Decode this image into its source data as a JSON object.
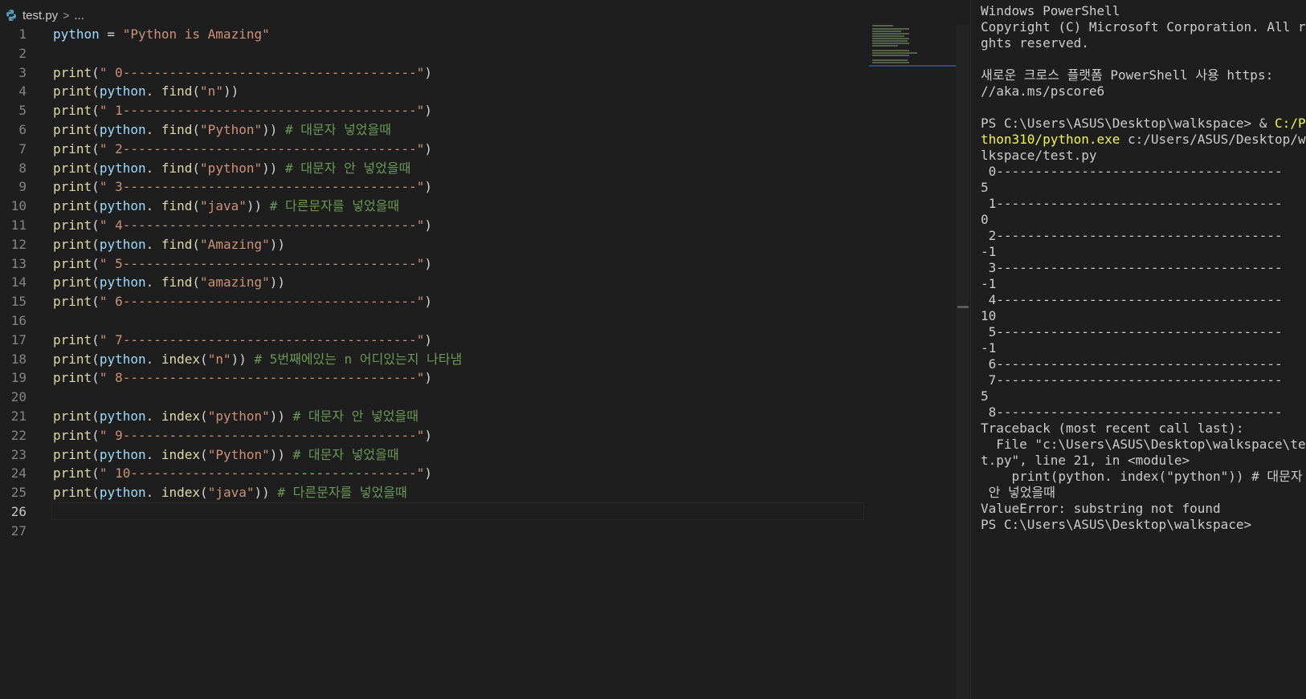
{
  "editor": {
    "breadcrumb": {
      "file": "test.py",
      "separator": ">",
      "more": "..."
    },
    "current_line": 26,
    "lines": [
      {
        "n": "1",
        "tokens": [
          [
            "var",
            "python"
          ],
          [
            "p",
            " = "
          ],
          [
            "str",
            "\"Python is Amazing\""
          ]
        ]
      },
      {
        "n": "2",
        "tokens": []
      },
      {
        "n": "3",
        "tokens": [
          [
            "fn",
            "print"
          ],
          [
            "p",
            "("
          ],
          [
            "str",
            "\" 0--------------------------------------\""
          ],
          [
            "p",
            ")"
          ]
        ]
      },
      {
        "n": "4",
        "tokens": [
          [
            "fn",
            "print"
          ],
          [
            "p",
            "("
          ],
          [
            "var",
            "python"
          ],
          [
            "p",
            ". "
          ],
          [
            "fn",
            "find"
          ],
          [
            "p",
            "("
          ],
          [
            "str",
            "\"n\""
          ],
          [
            "p",
            "))"
          ]
        ]
      },
      {
        "n": "5",
        "tokens": [
          [
            "fn",
            "print"
          ],
          [
            "p",
            "("
          ],
          [
            "str",
            "\" 1--------------------------------------\""
          ],
          [
            "p",
            ")"
          ]
        ]
      },
      {
        "n": "6",
        "tokens": [
          [
            "fn",
            "print"
          ],
          [
            "p",
            "("
          ],
          [
            "var",
            "python"
          ],
          [
            "p",
            ". "
          ],
          [
            "fn",
            "find"
          ],
          [
            "p",
            "("
          ],
          [
            "str",
            "\"Python\""
          ],
          [
            "p",
            ")) "
          ],
          [
            "cm",
            "# 대문자 넣었을때"
          ]
        ]
      },
      {
        "n": "7",
        "tokens": [
          [
            "fn",
            "print"
          ],
          [
            "p",
            "("
          ],
          [
            "str",
            "\" 2--------------------------------------\""
          ],
          [
            "p",
            ")"
          ]
        ]
      },
      {
        "n": "8",
        "tokens": [
          [
            "fn",
            "print"
          ],
          [
            "p",
            "("
          ],
          [
            "var",
            "python"
          ],
          [
            "p",
            ". "
          ],
          [
            "fn",
            "find"
          ],
          [
            "p",
            "("
          ],
          [
            "str",
            "\"python\""
          ],
          [
            "p",
            ")) "
          ],
          [
            "cm",
            "# 대문자 안 넣었을때"
          ]
        ]
      },
      {
        "n": "9",
        "tokens": [
          [
            "fn",
            "print"
          ],
          [
            "p",
            "("
          ],
          [
            "str",
            "\" 3--------------------------------------\""
          ],
          [
            "p",
            ")"
          ]
        ]
      },
      {
        "n": "10",
        "tokens": [
          [
            "fn",
            "print"
          ],
          [
            "p",
            "("
          ],
          [
            "var",
            "python"
          ],
          [
            "p",
            ". "
          ],
          [
            "fn",
            "find"
          ],
          [
            "p",
            "("
          ],
          [
            "str",
            "\"java\""
          ],
          [
            "p",
            ")) "
          ],
          [
            "cm",
            "# 다른문자를 넣었을때"
          ]
        ]
      },
      {
        "n": "11",
        "tokens": [
          [
            "fn",
            "print"
          ],
          [
            "p",
            "("
          ],
          [
            "str",
            "\" 4--------------------------------------\""
          ],
          [
            "p",
            ")"
          ]
        ]
      },
      {
        "n": "12",
        "tokens": [
          [
            "fn",
            "print"
          ],
          [
            "p",
            "("
          ],
          [
            "var",
            "python"
          ],
          [
            "p",
            ". "
          ],
          [
            "fn",
            "find"
          ],
          [
            "p",
            "("
          ],
          [
            "str",
            "\"Amazing\""
          ],
          [
            "p",
            "))"
          ]
        ]
      },
      {
        "n": "13",
        "tokens": [
          [
            "fn",
            "print"
          ],
          [
            "p",
            "("
          ],
          [
            "str",
            "\" 5--------------------------------------\""
          ],
          [
            "p",
            ")"
          ]
        ]
      },
      {
        "n": "14",
        "tokens": [
          [
            "fn",
            "print"
          ],
          [
            "p",
            "("
          ],
          [
            "var",
            "python"
          ],
          [
            "p",
            ". "
          ],
          [
            "fn",
            "find"
          ],
          [
            "p",
            "("
          ],
          [
            "str",
            "\"amazing\""
          ],
          [
            "p",
            "))"
          ]
        ]
      },
      {
        "n": "15",
        "tokens": [
          [
            "fn",
            "print"
          ],
          [
            "p",
            "("
          ],
          [
            "str",
            "\" 6--------------------------------------\""
          ],
          [
            "p",
            ")"
          ]
        ]
      },
      {
        "n": "16",
        "tokens": []
      },
      {
        "n": "17",
        "tokens": [
          [
            "fn",
            "print"
          ],
          [
            "p",
            "("
          ],
          [
            "str",
            "\" 7--------------------------------------\""
          ],
          [
            "p",
            ")"
          ]
        ]
      },
      {
        "n": "18",
        "tokens": [
          [
            "fn",
            "print"
          ],
          [
            "p",
            "("
          ],
          [
            "var",
            "python"
          ],
          [
            "p",
            ". "
          ],
          [
            "fn",
            "index"
          ],
          [
            "p",
            "("
          ],
          [
            "str",
            "\"n\""
          ],
          [
            "p",
            ")) "
          ],
          [
            "cm",
            "# 5번째에있는 n 어디있는지 나타냄"
          ]
        ]
      },
      {
        "n": "19",
        "tokens": [
          [
            "fn",
            "print"
          ],
          [
            "p",
            "("
          ],
          [
            "str",
            "\" 8--------------------------------------\""
          ],
          [
            "p",
            ")"
          ]
        ]
      },
      {
        "n": "20",
        "tokens": []
      },
      {
        "n": "21",
        "tokens": [
          [
            "fn",
            "print"
          ],
          [
            "p",
            "("
          ],
          [
            "var",
            "python"
          ],
          [
            "p",
            ". "
          ],
          [
            "fn",
            "index"
          ],
          [
            "p",
            "("
          ],
          [
            "str",
            "\"python\""
          ],
          [
            "p",
            ")) "
          ],
          [
            "cm",
            "# 대문자 안 넣었을때"
          ]
        ]
      },
      {
        "n": "22",
        "tokens": [
          [
            "fn",
            "print"
          ],
          [
            "p",
            "("
          ],
          [
            "str",
            "\" 9--------------------------------------\""
          ],
          [
            "p",
            ")"
          ]
        ]
      },
      {
        "n": "23",
        "tokens": [
          [
            "fn",
            "print"
          ],
          [
            "p",
            "("
          ],
          [
            "var",
            "python"
          ],
          [
            "p",
            ". "
          ],
          [
            "fn",
            "index"
          ],
          [
            "p",
            "("
          ],
          [
            "str",
            "\"Python\""
          ],
          [
            "p",
            ")) "
          ],
          [
            "cm",
            "# 대문자 넣었을때"
          ]
        ]
      },
      {
        "n": "24",
        "tokens": [
          [
            "fn",
            "print"
          ],
          [
            "p",
            "("
          ],
          [
            "str",
            "\" 10-------------------------------------\""
          ],
          [
            "p",
            ")"
          ]
        ]
      },
      {
        "n": "25",
        "tokens": [
          [
            "fn",
            "print"
          ],
          [
            "p",
            "("
          ],
          [
            "var",
            "python"
          ],
          [
            "p",
            ". "
          ],
          [
            "fn",
            "index"
          ],
          [
            "p",
            "("
          ],
          [
            "str",
            "\"java\""
          ],
          [
            "p",
            ")) "
          ],
          [
            "cm",
            "# 다른문자를 넣었을때"
          ]
        ]
      },
      {
        "n": "26",
        "tokens": []
      },
      {
        "n": "27",
        "tokens": []
      }
    ]
  },
  "terminal": {
    "lines": [
      [
        [
          "",
          "Windows PowerShell"
        ]
      ],
      [
        [
          "",
          "Copyright (C) Microsoft Corporation. All ri"
        ]
      ],
      [
        [
          "",
          "ghts reserved."
        ]
      ],
      [
        [
          "",
          ""
        ]
      ],
      [
        [
          "",
          "새로운 크로스 플랫폼 PowerShell 사용 https:"
        ]
      ],
      [
        [
          "",
          "//aka.ms/pscore6"
        ]
      ],
      [
        [
          "",
          ""
        ]
      ],
      [
        [
          "",
          "PS C:\\Users\\ASUS\\Desktop\\walkspace> & "
        ],
        [
          "yl",
          "C:/Py"
        ]
      ],
      [
        [
          "yl",
          "thon310/python.exe"
        ],
        [
          "",
          " c:/Users/ASUS/Desktop/wa"
        ]
      ],
      [
        [
          "",
          "lkspace/test.py"
        ]
      ],
      [
        [
          "",
          " 0-------------------------------------"
        ]
      ],
      [
        [
          "",
          "5"
        ]
      ],
      [
        [
          "",
          " 1-------------------------------------"
        ]
      ],
      [
        [
          "",
          "0"
        ]
      ],
      [
        [
          "",
          " 2-------------------------------------"
        ]
      ],
      [
        [
          "",
          "-1"
        ]
      ],
      [
        [
          "",
          " 3-------------------------------------"
        ]
      ],
      [
        [
          "",
          "-1"
        ]
      ],
      [
        [
          "",
          " 4-------------------------------------"
        ]
      ],
      [
        [
          "",
          "10"
        ]
      ],
      [
        [
          "",
          " 5-------------------------------------"
        ]
      ],
      [
        [
          "",
          "-1"
        ]
      ],
      [
        [
          "",
          " 6-------------------------------------"
        ]
      ],
      [
        [
          "",
          " 7-------------------------------------"
        ]
      ],
      [
        [
          "",
          "5"
        ]
      ],
      [
        [
          "",
          " 8-------------------------------------"
        ]
      ],
      [
        [
          "",
          "Traceback (most recent call last):"
        ]
      ],
      [
        [
          "",
          "  File \"c:\\Users\\ASUS\\Desktop\\walkspace\\tes"
        ]
      ],
      [
        [
          "",
          "t.py\", line 21, in <module>"
        ]
      ],
      [
        [
          "",
          "    print(python. index(\"python\")) # 대문자"
        ]
      ],
      [
        [
          "",
          " 안 넣었을때"
        ]
      ],
      [
        [
          "",
          "ValueError: substring not found"
        ]
      ],
      [
        [
          "",
          "PS C:\\Users\\ASUS\\Desktop\\walkspace>"
        ]
      ]
    ]
  },
  "colors": {
    "background": "#1e1e1e",
    "function": "#dcdcaa",
    "variable": "#9cdcfe",
    "string": "#ce9178",
    "comment": "#6a9955",
    "terminal_highlight": "#f5f543"
  }
}
